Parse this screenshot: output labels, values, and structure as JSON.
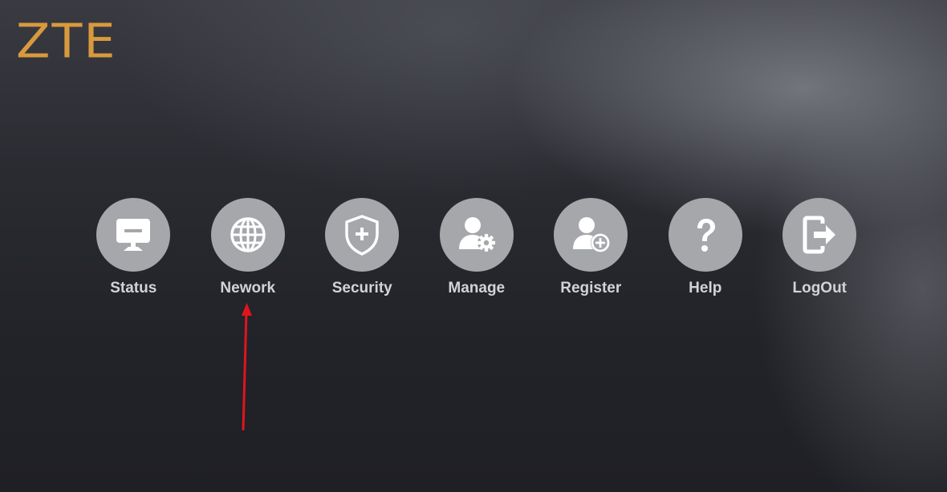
{
  "brand": {
    "logo_text": "ZTE",
    "logo_color": "#d89a3d"
  },
  "menu": {
    "items": [
      {
        "label": "Status",
        "icon": "monitor-icon"
      },
      {
        "label": "Nework",
        "icon": "globe-icon"
      },
      {
        "label": "Security",
        "icon": "shield-plus-icon"
      },
      {
        "label": "Manage",
        "icon": "user-gear-icon"
      },
      {
        "label": "Register",
        "icon": "user-add-icon"
      },
      {
        "label": "Help",
        "icon": "question-icon"
      },
      {
        "label": "LogOut",
        "icon": "logout-icon"
      }
    ]
  },
  "colors": {
    "icon_circle": "#a6a7ab",
    "label_text": "#d2d3d7",
    "annotation_arrow": "#e0141e"
  }
}
